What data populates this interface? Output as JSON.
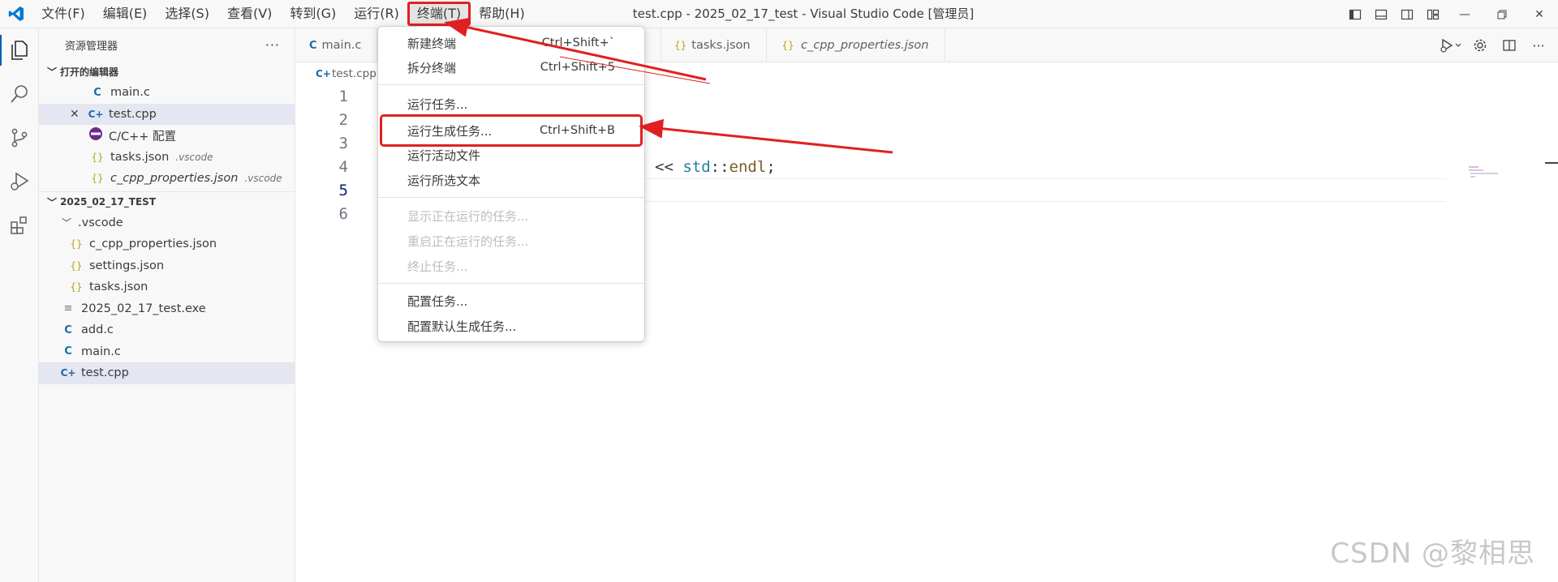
{
  "menubar": {
    "items": [
      "文件(F)",
      "编辑(E)",
      "选择(S)",
      "查看(V)",
      "转到(G)",
      "运行(R)",
      "终端(T)",
      "帮助(H)"
    ],
    "active_index": 6
  },
  "window": {
    "title": "test.cpp - 2025_02_17_test - Visual Studio Code [管理员]"
  },
  "sidebar": {
    "title": "资源管理器",
    "more_label": "···",
    "open_editors": {
      "header": "打开的编辑器",
      "items": [
        {
          "name": "main.c",
          "icon": "C",
          "desc": ""
        },
        {
          "name": "test.cpp",
          "icon": "C++",
          "desc": "",
          "selected": true
        },
        {
          "name": "C/C++ 配置",
          "icon": "gear",
          "desc": ""
        },
        {
          "name": "tasks.json",
          "icon": "{}",
          "desc": ".vscode"
        },
        {
          "name": "c_cpp_properties.json",
          "icon": "{}",
          "desc": ".vscode"
        }
      ]
    },
    "folder": {
      "header": "2025_02_17_TEST",
      "items": [
        {
          "name": ".vscode",
          "icon": "folder"
        },
        {
          "name": "c_cpp_properties.json",
          "icon": "{}"
        },
        {
          "name": "settings.json",
          "icon": "{}"
        },
        {
          "name": "tasks.json",
          "icon": "{}"
        },
        {
          "name": "2025_02_17_test.exe",
          "icon": "exe"
        },
        {
          "name": "add.c",
          "icon": "C"
        },
        {
          "name": "main.c",
          "icon": "C"
        },
        {
          "name": "test.cpp",
          "icon": "C++"
        }
      ]
    }
  },
  "tabs": [
    {
      "label": "main.c",
      "icon": "C"
    },
    {
      "label": "tasks.json",
      "icon": "{}"
    },
    {
      "label": "c_cpp_properties.json",
      "icon": "{}"
    }
  ],
  "breadcrumb": "test.cpp",
  "editor": {
    "line_numbers": [
      "1",
      "2",
      "3",
      "4",
      "5",
      "6"
    ],
    "current_line": 5,
    "line4_code": {
      "op": "<< ",
      "ns": "std",
      "sep": "::",
      "fn": "endl",
      "end": ";"
    }
  },
  "terminal_menu": {
    "items": [
      {
        "label": "新建终端",
        "shortcut": "Ctrl+Shift+`",
        "disabled": false
      },
      {
        "label": "拆分终端",
        "shortcut": "Ctrl+Shift+5",
        "disabled": false
      },
      {
        "label": "运行任务...",
        "shortcut": "",
        "disabled": false
      },
      {
        "label": "运行生成任务...",
        "shortcut": "Ctrl+Shift+B",
        "disabled": false,
        "highlighted": true
      },
      {
        "label": "运行活动文件",
        "shortcut": "",
        "disabled": false
      },
      {
        "label": "运行所选文本",
        "shortcut": "",
        "disabled": false
      },
      {
        "label": "显示正在运行的任务...",
        "shortcut": "",
        "disabled": true
      },
      {
        "label": "重启正在运行的任务...",
        "shortcut": "",
        "disabled": true
      },
      {
        "label": "终止任务...",
        "shortcut": "",
        "disabled": true
      },
      {
        "label": "配置任务...",
        "shortcut": "",
        "disabled": false
      },
      {
        "label": "配置默认生成任务...",
        "shortcut": "",
        "disabled": false
      }
    ]
  },
  "watermark": "CSDN @黎相思",
  "colors": {
    "accent": "#005fb8",
    "annotation_red": "#e02020",
    "c_icon": "#1c6ba8",
    "json_icon": "#b8a407"
  }
}
